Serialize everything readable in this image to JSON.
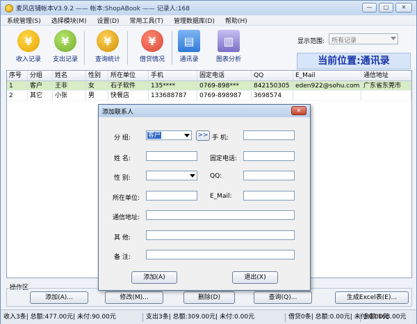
{
  "window": {
    "title": "麦风店铺帐本V3.9.2  ——  帐本:ShopABook —— 记录人:168"
  },
  "window_buttons": {
    "minimize": "—",
    "maximize": "□",
    "close": "✕"
  },
  "menu": [
    "系统管理(S)",
    "选择模块(M)",
    "设置(D)",
    "常用工具(T)",
    "管理数据库(D)",
    "帮助(H)"
  ],
  "toolbar": {
    "items": [
      {
        "label": "收入记录",
        "icon": "income-icon",
        "glyph": "¥",
        "color": "#e7a400"
      },
      {
        "label": "支出记录",
        "icon": "expense-icon",
        "glyph": "¥",
        "color": "#6fae2b"
      },
      {
        "label": "查询统计",
        "icon": "query-stats-icon",
        "glyph": "¥",
        "color": "#d08f00"
      },
      {
        "label": "借贷情况",
        "icon": "loan-icon",
        "glyph": "¥",
        "color": "#d8453a"
      },
      {
        "label": "通讯录",
        "icon": "address-book-icon",
        "glyph": "▤",
        "color": "#2f7ad8"
      },
      {
        "label": "图表分析",
        "icon": "chart-analysis-icon",
        "glyph": "▥",
        "color": "#7a6fc6"
      }
    ],
    "range_label": "显示范围:",
    "range_value": "所有记录"
  },
  "current_position": "当前位置:通讯录",
  "table": {
    "columns": [
      "序号",
      "分组",
      "姓名",
      "性别",
      "所在单位",
      "手机",
      "固定电话",
      "QQ",
      "E_Mail",
      "通信地址"
    ],
    "rows": [
      [
        "1",
        "客户",
        "王非",
        "女",
        "石子软件",
        "135****",
        "0769-898***",
        "842150305",
        "eden922@sohu.com",
        "广东省东莞市"
      ],
      [
        "2",
        "其它",
        "小张",
        "男",
        "快餐店",
        "133688787",
        "0769-898987",
        "3698574",
        "",
        ""
      ]
    ]
  },
  "ops": {
    "label": "操作区",
    "add": "添加(A)...",
    "edit": "修改(M)...",
    "delete": "删除(D)",
    "search": "查询(Q)...",
    "excel": "生成Excel表(E)..."
  },
  "status": [
    "收入3条| 总额:477.00元| 未付:90.00元",
    "支出3条| 总额:309.00元| 未付:0.00元",
    "借贷0条| 总额:0.00元| 未付:0.00元",
    "余额:168.00元"
  ],
  "dialog": {
    "title": "添加联系人",
    "close": "✕",
    "fields": {
      "group": "分  组:",
      "group_value": "客户",
      "mobile": "手  机:",
      "name": "姓  名:",
      "phone": "固定电话:",
      "gender": "性  别:",
      "qq": "QQ:",
      "company": "所在单位:",
      "email": "E_Mail:",
      "address": "通信地址:",
      "other": "其  他:",
      "note": "备  注:"
    },
    "pick_btn": ">>",
    "add_btn": "添加(A)",
    "exit_btn": "退出(X)"
  }
}
